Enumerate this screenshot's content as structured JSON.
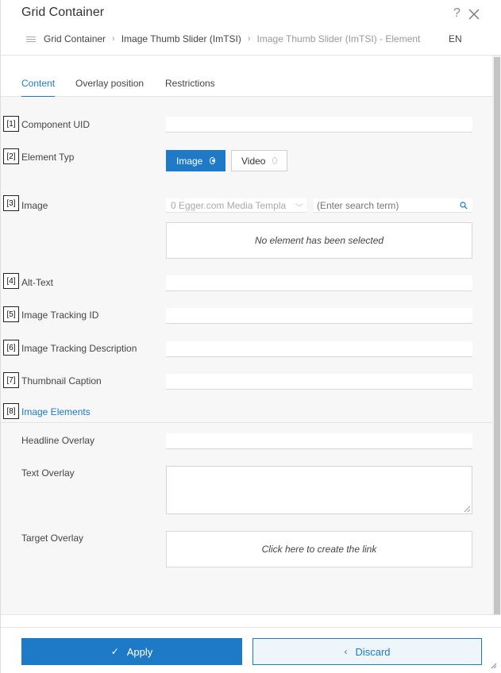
{
  "header": {
    "title": "Grid Container",
    "help_symbol": "?",
    "breadcrumb": [
      "Grid Container",
      "Image Thumb Slider (ImTSI)",
      "Image Thumb Slider (ImTSI) - Element"
    ],
    "language": "EN"
  },
  "tabs": [
    {
      "label": "Content",
      "active": true
    },
    {
      "label": "Overlay position",
      "active": false
    },
    {
      "label": "Restrictions",
      "active": false
    }
  ],
  "fields": {
    "component_uid": {
      "badge": "[1]",
      "label": "Component UID",
      "value": ""
    },
    "element_type": {
      "badge": "[2]",
      "label": "Element Typ",
      "options": [
        "Image",
        "Video"
      ],
      "selected": "Image"
    },
    "image": {
      "badge": "[3]",
      "label": "Image",
      "source_select": "0 Egger.com Media Templa",
      "search_placeholder": "(Enter search term)",
      "empty_text": "No element has been selected"
    },
    "alt_text": {
      "badge": "[4]",
      "label": "Alt-Text",
      "value": ""
    },
    "tracking_id": {
      "badge": "[5]",
      "label": "Image Tracking ID",
      "value": ""
    },
    "tracking_desc": {
      "badge": "[6]",
      "label": "Image Tracking Description",
      "value": ""
    },
    "thumbnail_caption": {
      "badge": "[7]",
      "label": "Thumbnail Caption",
      "value": ""
    },
    "image_elements": {
      "badge": "[8]",
      "label": "Image Elements"
    }
  },
  "overlay": {
    "headline_label": "Headline Overlay",
    "text_label": "Text Overlay",
    "target_label": "Target Overlay",
    "target_link_text": "Click here to create the link"
  },
  "footer": {
    "apply_label": "Apply",
    "discard_label": "Discard"
  },
  "colors": {
    "accent": "#1e7ac7",
    "panel_bg": "#f7f7f7"
  }
}
